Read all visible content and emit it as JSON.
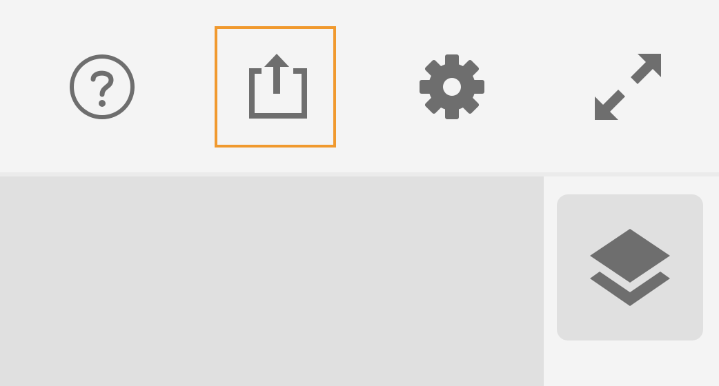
{
  "toolbar": {
    "buttons": [
      {
        "name": "help",
        "icon": "help-circle-icon",
        "selected": false
      },
      {
        "name": "share",
        "icon": "share-upload-icon",
        "selected": true
      },
      {
        "name": "settings",
        "icon": "gear-icon",
        "selected": false
      },
      {
        "name": "fullscreen",
        "icon": "expand-arrows-icon",
        "selected": false
      }
    ],
    "selected_outline_color": "#f0992e",
    "icon_color": "#6e6e6e"
  },
  "side_panel": {
    "layers_button": {
      "icon": "layers-icon"
    }
  }
}
